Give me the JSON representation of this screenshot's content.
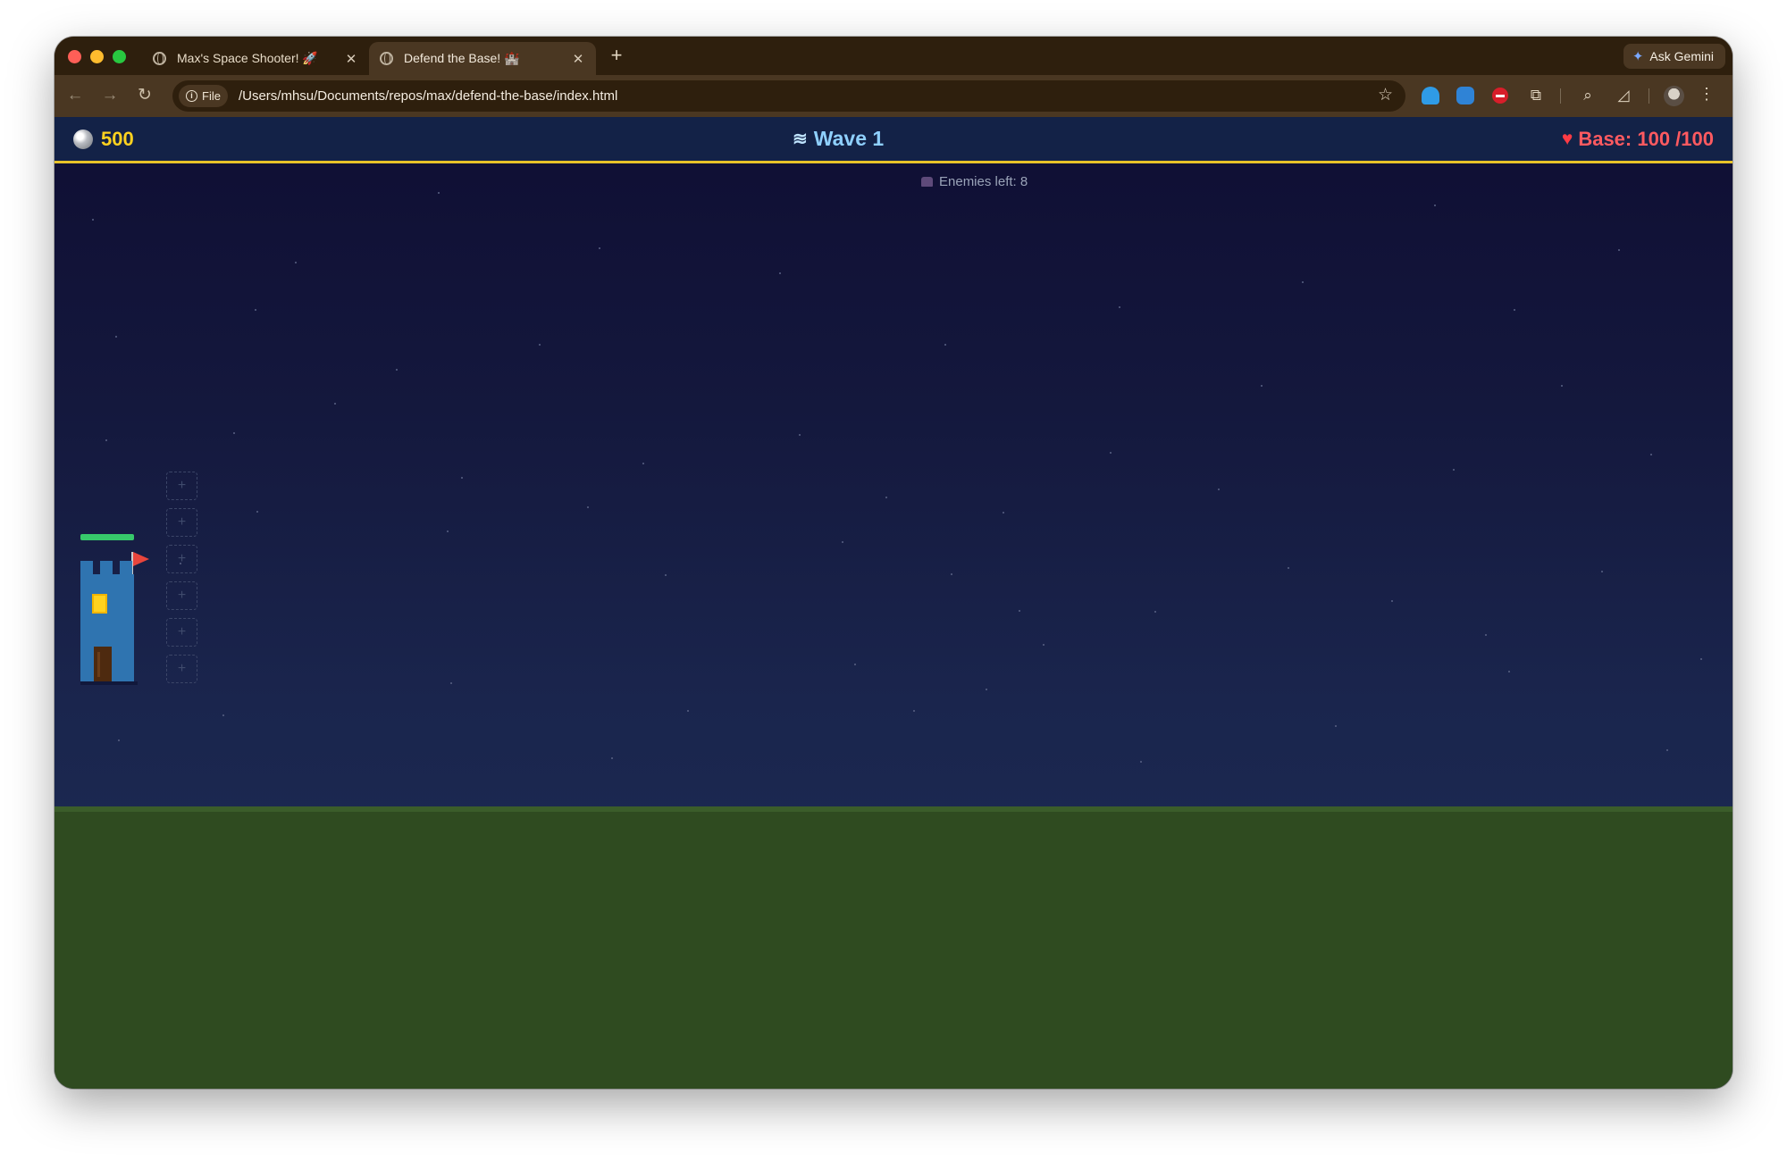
{
  "browser": {
    "tabs": [
      {
        "title": "Max's Space Shooter! 🚀",
        "active": false
      },
      {
        "title": "Defend the Base! 🏰",
        "active": true
      }
    ],
    "new_tab_label": "+",
    "close_label": "✕",
    "ask_gemini_label": "Ask Gemini",
    "address": {
      "scheme_chip": "File",
      "url": "/Users/mhsu/Documents/repos/max/defend-the-base/index.html"
    }
  },
  "game": {
    "hud": {
      "coins": "500",
      "wave_label": "Wave 1",
      "base_label": "Base: 100 /100"
    },
    "enemies_left_label": "Enemies left: 8",
    "tower_health_fraction": 1.0,
    "build_slot_label": "+",
    "colors": {
      "hud_bg": "#132247",
      "hud_border": "#e8c229",
      "coins": "#ffd21f",
      "wave": "#8fd0ff",
      "base": "#ff5a60",
      "tower": "#2f74b0",
      "health": "#37c96b",
      "ground": "#2f4b20"
    }
  }
}
